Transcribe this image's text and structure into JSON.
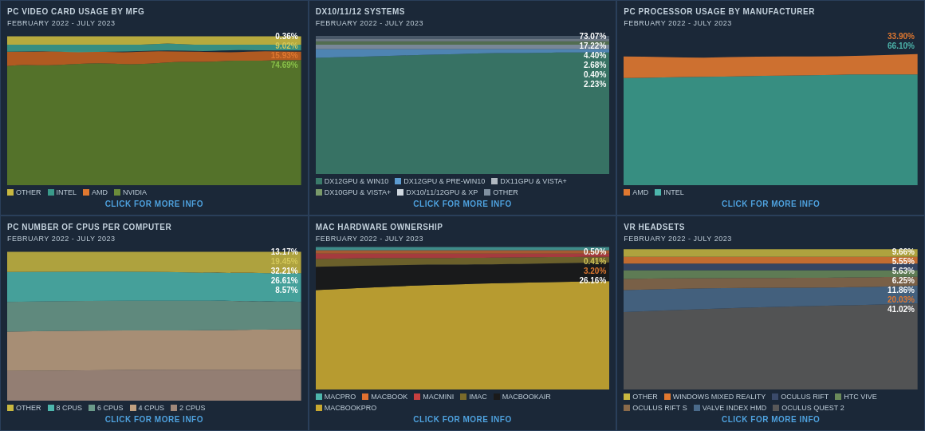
{
  "panels": [
    {
      "id": "pc-video-card",
      "title": "PC VIDEO CARD USAGE BY MFG",
      "date_range": "FEBRUARY 2022 - JULY 2023",
      "click_label": "CLICK FOR MORE INFO",
      "values": [
        {
          "val": "0.36%",
          "class": "val-white"
        },
        {
          "val": "9.02%",
          "class": "val-yellow"
        },
        {
          "val": "15.93%",
          "class": "val-orange"
        },
        {
          "val": "74.69%",
          "class": "val-green"
        }
      ],
      "legend": [
        {
          "label": "OTHER",
          "color": "#c8b84a"
        },
        {
          "label": "INTEL",
          "color": "#4db6ac"
        },
        {
          "label": "AMD",
          "color": "#e07830"
        },
        {
          "label": "NVIDIA",
          "color": "#6b8c3a"
        }
      ],
      "chart_type": "area_stacked_1"
    },
    {
      "id": "dx-systems",
      "title": "DX10/11/12 SYSTEMS",
      "date_range": "FEBRUARY 2022 - JULY 2023",
      "click_label": "CLICK FOR MORE INFO",
      "values": [
        {
          "val": "73.07%",
          "class": "val-white"
        },
        {
          "val": "17.22%",
          "class": "val-white"
        },
        {
          "val": "4.40%",
          "class": "val-white"
        },
        {
          "val": "2.68%",
          "class": "val-white"
        },
        {
          "val": "0.40%",
          "class": "val-white"
        },
        {
          "val": "2.23%",
          "class": "val-white"
        }
      ],
      "legend": [
        {
          "label": "DX12GPU & WIN10",
          "color": "#4a7a6a"
        },
        {
          "label": "DX12GPU & PRE-WIN10",
          "color": "#5c9bd1"
        },
        {
          "label": "DX11GPU & VISTA+",
          "color": "#b0b8c0"
        },
        {
          "label": "DX10GPU & VISTA+",
          "color": "#7a9a6a"
        },
        {
          "label": "DX10/11/12GPU & XP",
          "color": "#d0d8e0"
        },
        {
          "label": "OTHER",
          "color": "#8090a0"
        }
      ],
      "chart_type": "area_stacked_2"
    },
    {
      "id": "pc-processor",
      "title": "PC PROCESSOR USAGE BY MANUFACTURER",
      "date_range": "FEBRUARY 2022 - JULY 2023",
      "click_label": "CLICK FOR MORE INFO",
      "values": [
        {
          "val": "33.90%",
          "class": "val-orange"
        },
        {
          "val": "66.10%",
          "class": "val-teal"
        }
      ],
      "legend": [
        {
          "label": "AMD",
          "color": "#e07830"
        },
        {
          "label": "INTEL",
          "color": "#4db6ac"
        }
      ],
      "chart_type": "area_stacked_3"
    },
    {
      "id": "pc-cpus",
      "title": "PC NUMBER OF CPUS PER COMPUTER",
      "date_range": "FEBRUARY 2022 - JULY 2023",
      "click_label": "CLICK FOR MORE INFO",
      "values": [
        {
          "val": "13.17%",
          "class": "val-white"
        },
        {
          "val": "19.45%",
          "class": "val-yellow"
        },
        {
          "val": "32.21%",
          "class": "val-white"
        },
        {
          "val": "26.61%",
          "class": "val-white"
        },
        {
          "val": "8.57%",
          "class": "val-white"
        }
      ],
      "legend": [
        {
          "label": "OTHER",
          "color": "#c8b84a"
        },
        {
          "label": "8 CPUS",
          "color": "#4db6ac"
        },
        {
          "label": "6 CPUS",
          "color": "#6b9a8a"
        },
        {
          "label": "4 CPUS",
          "color": "#c0a080"
        },
        {
          "label": "2 CPUS",
          "color": "#a0887a"
        }
      ],
      "chart_type": "area_stacked_4"
    },
    {
      "id": "mac-hardware",
      "title": "MAC HARDWARE OWNERSHIP",
      "date_range": "FEBRUARY 2022 - JULY 2023",
      "click_label": "CLICK FOR MORE INFO",
      "values": [
        {
          "val": "0.50%",
          "class": "val-white"
        },
        {
          "val": "0.41%",
          "class": "val-yellow"
        },
        {
          "val": "3.20%",
          "class": "val-orange"
        },
        {
          "val": "26.16%",
          "class": "val-white"
        }
      ],
      "legend": [
        {
          "label": "MACPRO",
          "color": "#4db6ac"
        },
        {
          "label": "MACBOOK",
          "color": "#e07830"
        },
        {
          "label": "MACMINI",
          "color": "#c84a4a"
        },
        {
          "label": "IMAC",
          "color": "#8b7a3a"
        },
        {
          "label": "MACBOOKAIR",
          "color": "#2a2a2a"
        },
        {
          "label": "MACBOOKPRO",
          "color": "#6b6b6b"
        }
      ],
      "chart_type": "area_stacked_5"
    },
    {
      "id": "vr-headsets",
      "title": "VR HEADSETS",
      "date_range": "FEBRUARY 2022 - JULY 2023",
      "click_label": "CLICK FOR MORE INFO",
      "values": [
        {
          "val": "9.66%",
          "class": "val-white"
        },
        {
          "val": "5.55%",
          "class": "val-white"
        },
        {
          "val": "5.63%",
          "class": "val-white"
        },
        {
          "val": "6.25%",
          "class": "val-white"
        },
        {
          "val": "11.86%",
          "class": "val-white"
        },
        {
          "val": "20.03%",
          "class": "val-orange"
        },
        {
          "val": "41.02%",
          "class": "val-white"
        }
      ],
      "legend": [
        {
          "label": "OTHER",
          "color": "#c8b84a"
        },
        {
          "label": "WINDOWS MIXED REALITY",
          "color": "#e07830"
        },
        {
          "label": "OCULUS RIFT",
          "color": "#3a4a6a"
        },
        {
          "label": "HTC VIVE",
          "color": "#6a8a5a"
        },
        {
          "label": "OCULUS RIFT S",
          "color": "#8a6a4a"
        },
        {
          "label": "VALVE INDEX HMD",
          "color": "#4a6a8a"
        },
        {
          "label": "OCULUS QUEST 2",
          "color": "#5a5a5a"
        }
      ],
      "chart_type": "area_stacked_6"
    }
  ]
}
